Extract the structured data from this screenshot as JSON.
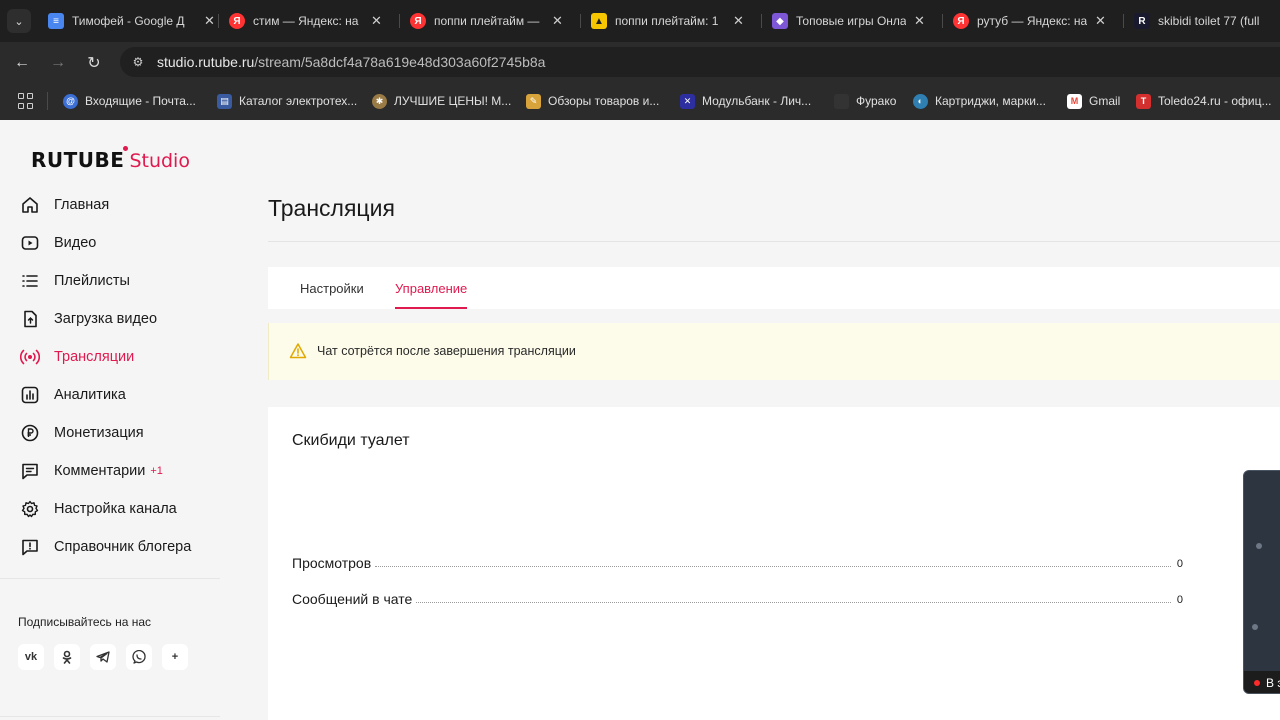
{
  "browser": {
    "tabs": [
      {
        "title": "Тимофей - Google Д",
        "favicon": "google-docs-icon",
        "color": "#4a86f0"
      },
      {
        "title": "стим — Яндекс: на",
        "favicon": "yandex-icon",
        "color": "#f33"
      },
      {
        "title": "поппи плейтайм —",
        "favicon": "yandex-icon",
        "color": "#f33"
      },
      {
        "title": "поппи плейтайм: 1",
        "favicon": "yandex-images-icon",
        "color": "#f7c600"
      },
      {
        "title": "Топовые игры Онла",
        "favicon": "game-icon",
        "color": "#7d57d6"
      },
      {
        "title": "рутуб — Яндекс: на",
        "favicon": "yandex-icon",
        "color": "#f33"
      },
      {
        "title": "skibidi toilet 77 (full",
        "favicon": "rutube-icon",
        "color": "#1a1a2e"
      }
    ],
    "url_host": "studio.rutube.ru",
    "url_path": "/stream/5a8dcf4a78a619e48d303a60f2745b8a",
    "bookmarks": [
      {
        "label": "Входящие - Почта...",
        "icon": "mail-icon",
        "color": "#3b6fd6"
      },
      {
        "label": "Каталог электротех...",
        "icon": "catalog-icon",
        "color": "#3a5ba0"
      },
      {
        "label": "ЛУЧШИЕ ЦЕНЫ! М...",
        "icon": "settings-icon",
        "color": "#9a7a45"
      },
      {
        "label": "Обзоры товаров и...",
        "icon": "pencil-icon",
        "color": "#d8a33a"
      },
      {
        "label": "Модульбанк - Лич...",
        "icon": "bank-icon",
        "color": "#2d2fa0"
      },
      {
        "label": "Фурако",
        "icon": "site-icon",
        "color": "#333333"
      },
      {
        "label": "Картриджи, марки...",
        "icon": "cartridge-icon",
        "color": "#2f7fb3"
      },
      {
        "label": "Gmail",
        "icon": "gmail-icon",
        "color": "#ea4335"
      },
      {
        "label": "Toledo24.ru - офиц...",
        "icon": "toledo-icon",
        "color": "#d32f2f"
      }
    ]
  },
  "logo": {
    "main": "RUTUBE",
    "sub": "Studio",
    "accent": "#e0194f"
  },
  "sidebar": {
    "items": [
      {
        "label": "Главная",
        "icon": "home-icon"
      },
      {
        "label": "Видео",
        "icon": "video-icon"
      },
      {
        "label": "Плейлисты",
        "icon": "playlist-icon"
      },
      {
        "label": "Загрузка видео",
        "icon": "upload-icon"
      },
      {
        "label": "Трансляции",
        "icon": "broadcast-icon",
        "active": true
      },
      {
        "label": "Аналитика",
        "icon": "analytics-icon"
      },
      {
        "label": "Монетизация",
        "icon": "ruble-icon"
      },
      {
        "label": "Комментарии",
        "icon": "comments-icon",
        "badge": "+1"
      },
      {
        "label": "Настройка канала",
        "icon": "gear-icon"
      },
      {
        "label": "Справочник блогера",
        "icon": "handbook-icon"
      }
    ],
    "follow_label": "Подписывайтесь на нас",
    "social": [
      {
        "label": "vk",
        "icon": "vk-icon"
      },
      {
        "label": "ok",
        "icon": "ok-icon"
      },
      {
        "label": "tg",
        "icon": "telegram-icon"
      },
      {
        "label": "viber",
        "icon": "viber-icon"
      },
      {
        "label": "+",
        "icon": "sparkle-icon"
      }
    ]
  },
  "main": {
    "title": "Трансляция",
    "tabs": [
      {
        "label": "Настройки"
      },
      {
        "label": "Управление",
        "active": true
      }
    ],
    "notice": "Чат сотрётся после завершения трансляции",
    "stream": {
      "name": "Скибиди туалет",
      "stats": [
        {
          "label": "Просмотров",
          "value": "0"
        },
        {
          "label": "Сообщений в чате",
          "value": "0"
        }
      ],
      "live_label": "В э"
    }
  }
}
